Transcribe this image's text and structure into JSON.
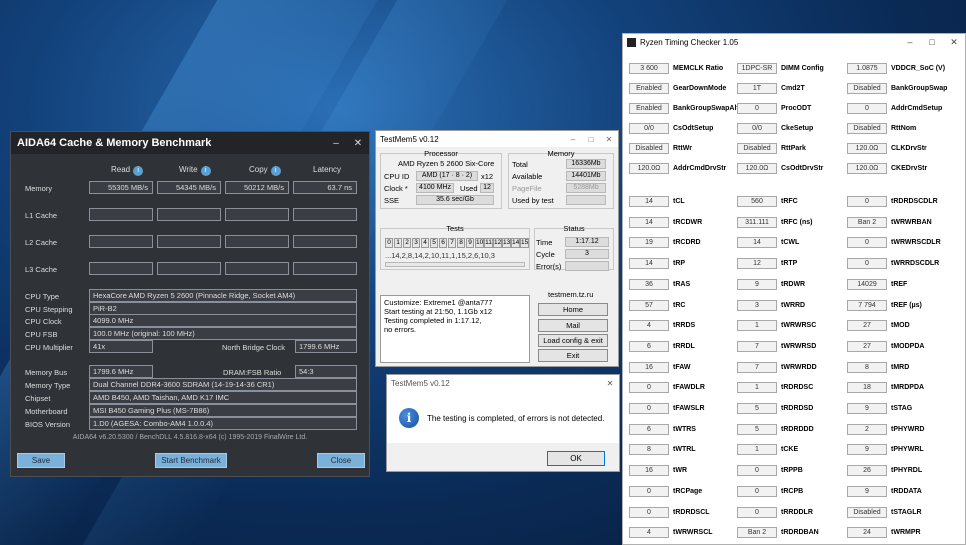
{
  "aida": {
    "title": "AIDA64 Cache & Memory Benchmark",
    "controls": {
      "minimize": "–",
      "close": "✕"
    },
    "columns": {
      "read": "Read",
      "write": "Write",
      "copy": "Copy",
      "latency": "Latency"
    },
    "memory": {
      "label": "Memory",
      "read": "55305 MB/s",
      "write": "54345 MB/s",
      "copy": "50212 MB/s",
      "latency": "63.7 ns"
    },
    "cache_labels": [
      "L1 Cache",
      "L2 Cache",
      "L3 Cache"
    ],
    "info_rows_1": [
      {
        "label": "CPU Type",
        "value": "HexaCore AMD Ryzen 5 2600  (Pinnacle Ridge, Socket AM4)"
      },
      {
        "label": "CPU Stepping",
        "value": "PiR-B2"
      },
      {
        "label": "CPU Clock",
        "value": "4099.0 MHz"
      },
      {
        "label": "CPU FSB",
        "value": "100.0 MHz  (original: 100 MHz)"
      },
      {
        "label": "CPU Multiplier",
        "value": "41x"
      }
    ],
    "nb_clock": {
      "label": "North Bridge Clock",
      "value": "1799.6 MHz"
    },
    "memory_bus": {
      "label": "Memory Bus",
      "value": "1799.6 MHz"
    },
    "dram_fsb": {
      "label": "DRAM:FSB Ratio",
      "value": "54:3"
    },
    "info_rows_2": [
      {
        "label": "Memory Type",
        "value": "Dual Channel DDR4-3600 SDRAM  (14-19-14-36 CR1)"
      },
      {
        "label": "Chipset",
        "value": "AMD B450, AMD Taishan, AMD K17 IMC"
      },
      {
        "label": "Motherboard",
        "value": "MSI B450 Gaming Plus (MS-7B86)"
      },
      {
        "label": "BIOS Version",
        "value": "1.D0  (AGESA: Combo-AM4 1.0.0.4)"
      }
    ],
    "footer": "AIDA64 v6.20.5300 / BenchDLL 4.5.816.8-x64  (c) 1995-2019 FinalWire Ltd.",
    "buttons": {
      "save": "Save",
      "start": "Start Benchmark",
      "close": "Close"
    }
  },
  "testmem": {
    "title": "TestMem5 v0.12",
    "controls": {
      "minimize": "–",
      "maximize": "□",
      "close": "✕"
    },
    "processor": {
      "group": "Processor",
      "name": "AMD Ryzen 5 2600 Six-Core",
      "cpu_id_label": "CPU ID",
      "cpu_id": "AMD  (17 · 8 · 2)",
      "threads": "x12",
      "clock_label": "Clock *",
      "clock": "4100 MHz",
      "used_label": "Used",
      "used": "12",
      "sse_label": "SSE",
      "sse": "35.6 sec/Gb"
    },
    "memory": {
      "group": "Memory",
      "total_label": "Total",
      "total": "16336Mb",
      "available_label": "Available",
      "available": "14401Mb",
      "pagefile_label": "PageFile",
      "pagefile": "5288Mb",
      "used_by_test_label": "Used by test",
      "used_by_test": ""
    },
    "tests": {
      "group": "Tests",
      "numbers": [
        "0",
        "1",
        "2",
        "3",
        "4",
        "5",
        "6",
        "7",
        "8",
        "9",
        "10",
        "11",
        "12",
        "13",
        "14",
        "15"
      ],
      "sequence": "...14,2,8,14,2,10,11,1,15,2,6,10,3"
    },
    "status": {
      "group": "Status",
      "time_label": "Time",
      "time": "1:17.12",
      "cycle_label": "Cycle",
      "cycle": "3",
      "errors_label": "Error(s)",
      "errors": ""
    },
    "log": [
      "Customize: Extreme1 @anta777",
      "Start testing at 21:50, 1.1Gb x12",
      "Testing completed in 1:17.12,",
      "no errors."
    ],
    "site": "testmem.tz.ru",
    "buttons": {
      "home": "Home",
      "mail": "Mail",
      "load": "Load config & exit",
      "exit": "Exit"
    }
  },
  "dialog": {
    "title": "TestMem5 v0.12",
    "close": "✕",
    "icon_glyph": "i",
    "message": "The testing is completed, of errors is not detected.",
    "ok": "OK"
  },
  "rtc": {
    "title": "Ryzen Timing Checker 1.05",
    "controls": {
      "minimize": "–",
      "maximize": "□",
      "close": "✕"
    },
    "top_rows": [
      [
        {
          "v": "3 600",
          "n": "MEMCLK Ratio"
        },
        {
          "v": "1DPC-SR",
          "n": "DIMM Config"
        },
        {
          "v": "1.0875",
          "n": "VDDCR_SoC (V)"
        }
      ],
      [
        {
          "v": "Enabled",
          "n": "GearDownMode"
        },
        {
          "v": "1T",
          "n": "Cmd2T"
        },
        {
          "v": "Disabled",
          "n": "BankGroupSwap"
        }
      ],
      [
        {
          "v": "Enabled",
          "n": "BankGroupSwapAlt"
        },
        {
          "v": "0",
          "n": "ProcODT"
        },
        {
          "v": "0",
          "n": "AddrCmdSetup"
        }
      ],
      [
        {
          "v": "0/0",
          "n": "CsOdtSetup"
        },
        {
          "v": "0/0",
          "n": "CkeSetup"
        },
        {
          "v": "Disabled",
          "n": "RttNom"
        }
      ],
      [
        {
          "v": "Disabled",
          "n": "RttWr"
        },
        {
          "v": "Disabled",
          "n": "RttPark"
        },
        {
          "v": "120.0Ω",
          "n": "CLKDrvStr"
        }
      ],
      [
        {
          "v": "120.0Ω",
          "n": "AddrCmdDrvStr"
        },
        {
          "v": "120.0Ω",
          "n": "CsOdtDrvStr"
        },
        {
          "v": "120.0Ω",
          "n": "CKEDrvStr"
        }
      ]
    ],
    "timing_rows": [
      [
        {
          "v": "14",
          "n": "tCL"
        },
        {
          "v": "560",
          "n": "tRFC"
        },
        {
          "v": "0",
          "n": "tRDRDSCDLR"
        }
      ],
      [
        {
          "v": "14",
          "n": "tRCDWR"
        },
        {
          "v": "311.111",
          "n": "tRFC (ns)"
        },
        {
          "v": "Ban 2",
          "n": "tWRWRBAN"
        }
      ],
      [
        {
          "v": "19",
          "n": "tRCDRD"
        },
        {
          "v": "14",
          "n": "tCWL"
        },
        {
          "v": "0",
          "n": "tWRWRSCDLR"
        }
      ],
      [
        {
          "v": "14",
          "n": "tRP"
        },
        {
          "v": "12",
          "n": "tRTP"
        },
        {
          "v": "0",
          "n": "tWRRDSCDLR"
        }
      ],
      [
        {
          "v": "36",
          "n": "tRAS"
        },
        {
          "v": "9",
          "n": "tRDWR"
        },
        {
          "v": "14029",
          "n": "tREF"
        }
      ],
      [
        {
          "v": "57",
          "n": "tRC"
        },
        {
          "v": "3",
          "n": "tWRRD"
        },
        {
          "v": "7 794",
          "n": "tREF (µs)"
        }
      ],
      [
        {
          "v": "4",
          "n": "tRRDS"
        },
        {
          "v": "1",
          "n": "tWRWRSC"
        },
        {
          "v": "27",
          "n": "tMOD"
        }
      ],
      [
        {
          "v": "6",
          "n": "tRRDL"
        },
        {
          "v": "7",
          "n": "tWRWRSD"
        },
        {
          "v": "27",
          "n": "tMODPDA"
        }
      ],
      [
        {
          "v": "16",
          "n": "tFAW"
        },
        {
          "v": "7",
          "n": "tWRWRDD"
        },
        {
          "v": "8",
          "n": "tMRD"
        }
      ],
      [
        {
          "v": "0",
          "n": "tFAWDLR"
        },
        {
          "v": "1",
          "n": "tRDRDSC"
        },
        {
          "v": "18",
          "n": "tMRDPDA"
        }
      ],
      [
        {
          "v": "0",
          "n": "tFAWSLR"
        },
        {
          "v": "5",
          "n": "tRDRDSD"
        },
        {
          "v": "9",
          "n": "tSTAG"
        }
      ],
      [
        {
          "v": "6",
          "n": "tWTRS"
        },
        {
          "v": "5",
          "n": "tRDRDDD"
        },
        {
          "v": "2",
          "n": "tPHYWRD"
        }
      ],
      [
        {
          "v": "8",
          "n": "tWTRL"
        },
        {
          "v": "1",
          "n": "tCKE"
        },
        {
          "v": "9",
          "n": "tPHYWRL"
        }
      ],
      [
        {
          "v": "16",
          "n": "tWR"
        },
        {
          "v": "0",
          "n": "tRPPB"
        },
        {
          "v": "26",
          "n": "tPHYRDL"
        }
      ],
      [
        {
          "v": "0",
          "n": "tRCPage"
        },
        {
          "v": "0",
          "n": "tRCPB"
        },
        {
          "v": "9",
          "n": "tRDDATA"
        }
      ],
      [
        {
          "v": "0",
          "n": "tRDRDSCL"
        },
        {
          "v": "0",
          "n": "tRRDDLR"
        },
        {
          "v": "Disabled",
          "n": "tSTAGLR"
        }
      ],
      [
        {
          "v": "4",
          "n": "tWRWRSCL"
        },
        {
          "v": "Ban 2",
          "n": "tRDRDBAN"
        },
        {
          "v": "24",
          "n": "tWRMPR"
        }
      ]
    ]
  }
}
